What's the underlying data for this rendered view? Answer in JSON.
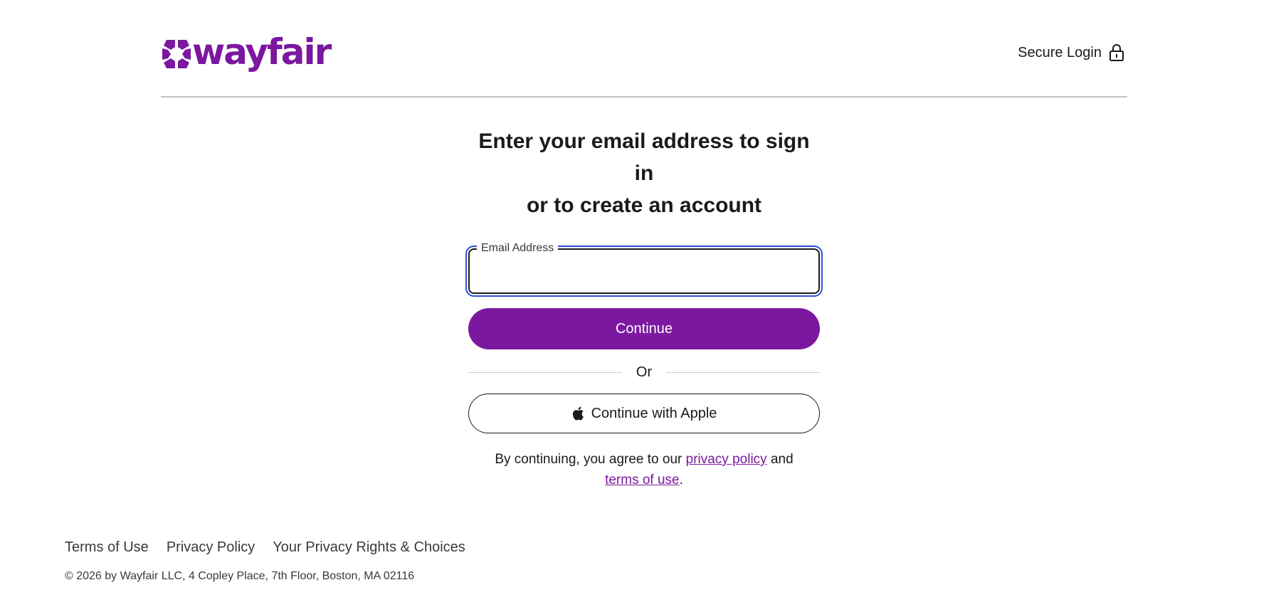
{
  "header": {
    "logo_text": "wayfair",
    "secure_login_label": "Secure Login",
    "icons": {
      "secure": "lock-icon",
      "logo": "wayfair-logo-mark"
    }
  },
  "main": {
    "heading_line1": "Enter your email address to sign in",
    "heading_line2": "or to create an account",
    "email_label": "Email Address",
    "email_value": "",
    "continue_label": "Continue",
    "divider_text": "Or",
    "apple_label": "Continue with Apple",
    "legal_prefix": "By continuing, you agree to our ",
    "privacy_link": "privacy policy",
    "legal_and": " and",
    "terms_link": "terms of use",
    "legal_suffix": "."
  },
  "footer": {
    "links": [
      "Terms of Use",
      "Privacy Policy",
      "Your Privacy Rights & Choices"
    ],
    "copyright": "© 2026 by Wayfair LLC, 4 Copley Place, 7th Floor, Boston, MA 02116"
  },
  "colors": {
    "brand": "#7b189f",
    "focus_ring": "#2b50d8",
    "rule": "#c4c4c4"
  }
}
